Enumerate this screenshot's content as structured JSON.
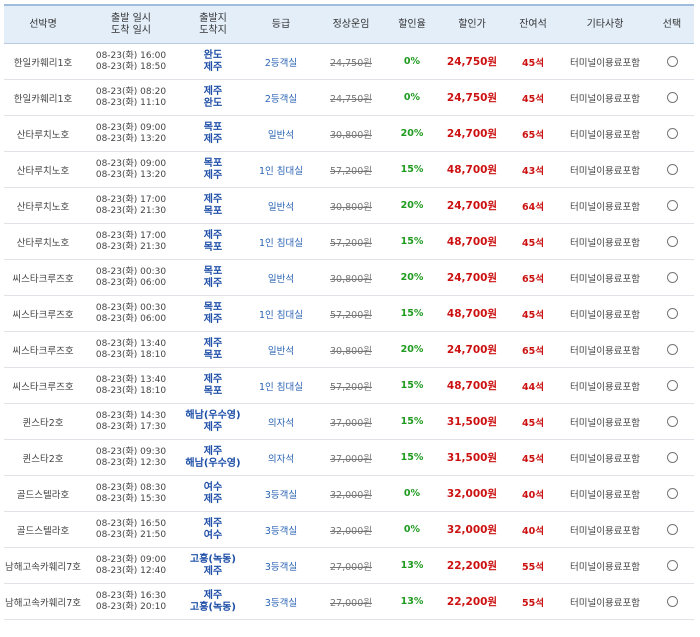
{
  "headers": {
    "ship": "선박명",
    "depart_line1": "출발 일시",
    "depart_line2": "도착 일시",
    "route_line1": "출발지",
    "route_line2": "도착지",
    "grade": "등급",
    "fare": "정상운임",
    "rate": "할인율",
    "price": "할인가",
    "seats": "잔여석",
    "etc": "기타사항",
    "select": "선택"
  },
  "rows": [
    {
      "ship": "한일카훼리1호",
      "dep": "08-23(화) 16:00",
      "arr": "08-23(화) 18:50",
      "from": "완도",
      "to": "제주",
      "grade": "2등객실",
      "fare": "24,750원",
      "rate": "0%",
      "price": "24,750원",
      "seats": "45석",
      "etc": "터미널이용료포함"
    },
    {
      "ship": "한일카훼리1호",
      "dep": "08-23(화) 08:20",
      "arr": "08-23(화) 11:10",
      "from": "제주",
      "to": "완도",
      "grade": "2등객실",
      "fare": "24,750원",
      "rate": "0%",
      "price": "24,750원",
      "seats": "45석",
      "etc": "터미널이용료포함"
    },
    {
      "ship": "산타루치노호",
      "dep": "08-23(화) 09:00",
      "arr": "08-23(화) 13:20",
      "from": "목포",
      "to": "제주",
      "grade": "일반석",
      "fare": "30,800원",
      "rate": "20%",
      "price": "24,700원",
      "seats": "65석",
      "etc": "터미널이용료포함"
    },
    {
      "ship": "산타루치노호",
      "dep": "08-23(화) 09:00",
      "arr": "08-23(화) 13:20",
      "from": "목포",
      "to": "제주",
      "grade": "1인 침대실",
      "fare": "57,200원",
      "rate": "15%",
      "price": "48,700원",
      "seats": "43석",
      "etc": "터미널이용료포함"
    },
    {
      "ship": "산타루치노호",
      "dep": "08-23(화) 17:00",
      "arr": "08-23(화) 21:30",
      "from": "제주",
      "to": "목포",
      "grade": "일반석",
      "fare": "30,800원",
      "rate": "20%",
      "price": "24,700원",
      "seats": "64석",
      "etc": "터미널이용료포함"
    },
    {
      "ship": "산타루치노호",
      "dep": "08-23(화) 17:00",
      "arr": "08-23(화) 21:30",
      "from": "제주",
      "to": "목포",
      "grade": "1인 침대실",
      "fare": "57,200원",
      "rate": "15%",
      "price": "48,700원",
      "seats": "45석",
      "etc": "터미널이용료포함"
    },
    {
      "ship": "씨스타크루즈호",
      "dep": "08-23(화) 00:30",
      "arr": "08-23(화) 06:00",
      "from": "목포",
      "to": "제주",
      "grade": "일반석",
      "fare": "30,800원",
      "rate": "20%",
      "price": "24,700원",
      "seats": "65석",
      "etc": "터미널이용료포함"
    },
    {
      "ship": "씨스타크루즈호",
      "dep": "08-23(화) 00:30",
      "arr": "08-23(화) 06:00",
      "from": "목포",
      "to": "제주",
      "grade": "1인 침대실",
      "fare": "57,200원",
      "rate": "15%",
      "price": "48,700원",
      "seats": "45석",
      "etc": "터미널이용료포함"
    },
    {
      "ship": "씨스타크루즈호",
      "dep": "08-23(화) 13:40",
      "arr": "08-23(화) 18:10",
      "from": "제주",
      "to": "목포",
      "grade": "일반석",
      "fare": "30,800원",
      "rate": "20%",
      "price": "24,700원",
      "seats": "65석",
      "etc": "터미널이용료포함"
    },
    {
      "ship": "씨스타크루즈호",
      "dep": "08-23(화) 13:40",
      "arr": "08-23(화) 18:10",
      "from": "제주",
      "to": "목포",
      "grade": "1인 침대실",
      "fare": "57,200원",
      "rate": "15%",
      "price": "48,700원",
      "seats": "44석",
      "etc": "터미널이용료포함"
    },
    {
      "ship": "퀸스타2호",
      "dep": "08-23(화) 14:30",
      "arr": "08-23(화) 17:30",
      "from": "해남(우수영)",
      "to": "제주",
      "grade": "의자석",
      "fare": "37,000원",
      "rate": "15%",
      "price": "31,500원",
      "seats": "45석",
      "etc": "터미널이용료포함"
    },
    {
      "ship": "퀸스타2호",
      "dep": "08-23(화) 09:30",
      "arr": "08-23(화) 12:30",
      "from": "제주",
      "to": "해남(우수영)",
      "grade": "의자석",
      "fare": "37,000원",
      "rate": "15%",
      "price": "31,500원",
      "seats": "45석",
      "etc": "터미널이용료포함"
    },
    {
      "ship": "골드스텔라호",
      "dep": "08-23(화) 08:30",
      "arr": "08-23(화) 15:30",
      "from": "여수",
      "to": "제주",
      "grade": "3등객실",
      "fare": "32,000원",
      "rate": "0%",
      "price": "32,000원",
      "seats": "40석",
      "etc": "터미널이용료포함"
    },
    {
      "ship": "골드스텔라호",
      "dep": "08-23(화) 16:50",
      "arr": "08-23(화) 21:50",
      "from": "제주",
      "to": "여수",
      "grade": "3등객실",
      "fare": "32,000원",
      "rate": "0%",
      "price": "32,000원",
      "seats": "40석",
      "etc": "터미널이용료포함"
    },
    {
      "ship": "남해고속카훼리7호",
      "dep": "08-23(화) 09:00",
      "arr": "08-23(화) 12:40",
      "from": "고흥(녹동)",
      "to": "제주",
      "grade": "3등객실",
      "fare": "27,000원",
      "rate": "13%",
      "price": "22,200원",
      "seats": "55석",
      "etc": "터미널이용료포함"
    },
    {
      "ship": "남해고속카훼리7호",
      "dep": "08-23(화) 16:30",
      "arr": "08-23(화) 20:10",
      "from": "제주",
      "to": "고흥(녹동)",
      "grade": "3등객실",
      "fare": "27,000원",
      "rate": "13%",
      "price": "22,200원",
      "seats": "55석",
      "etc": "터미널이용료포함"
    }
  ]
}
